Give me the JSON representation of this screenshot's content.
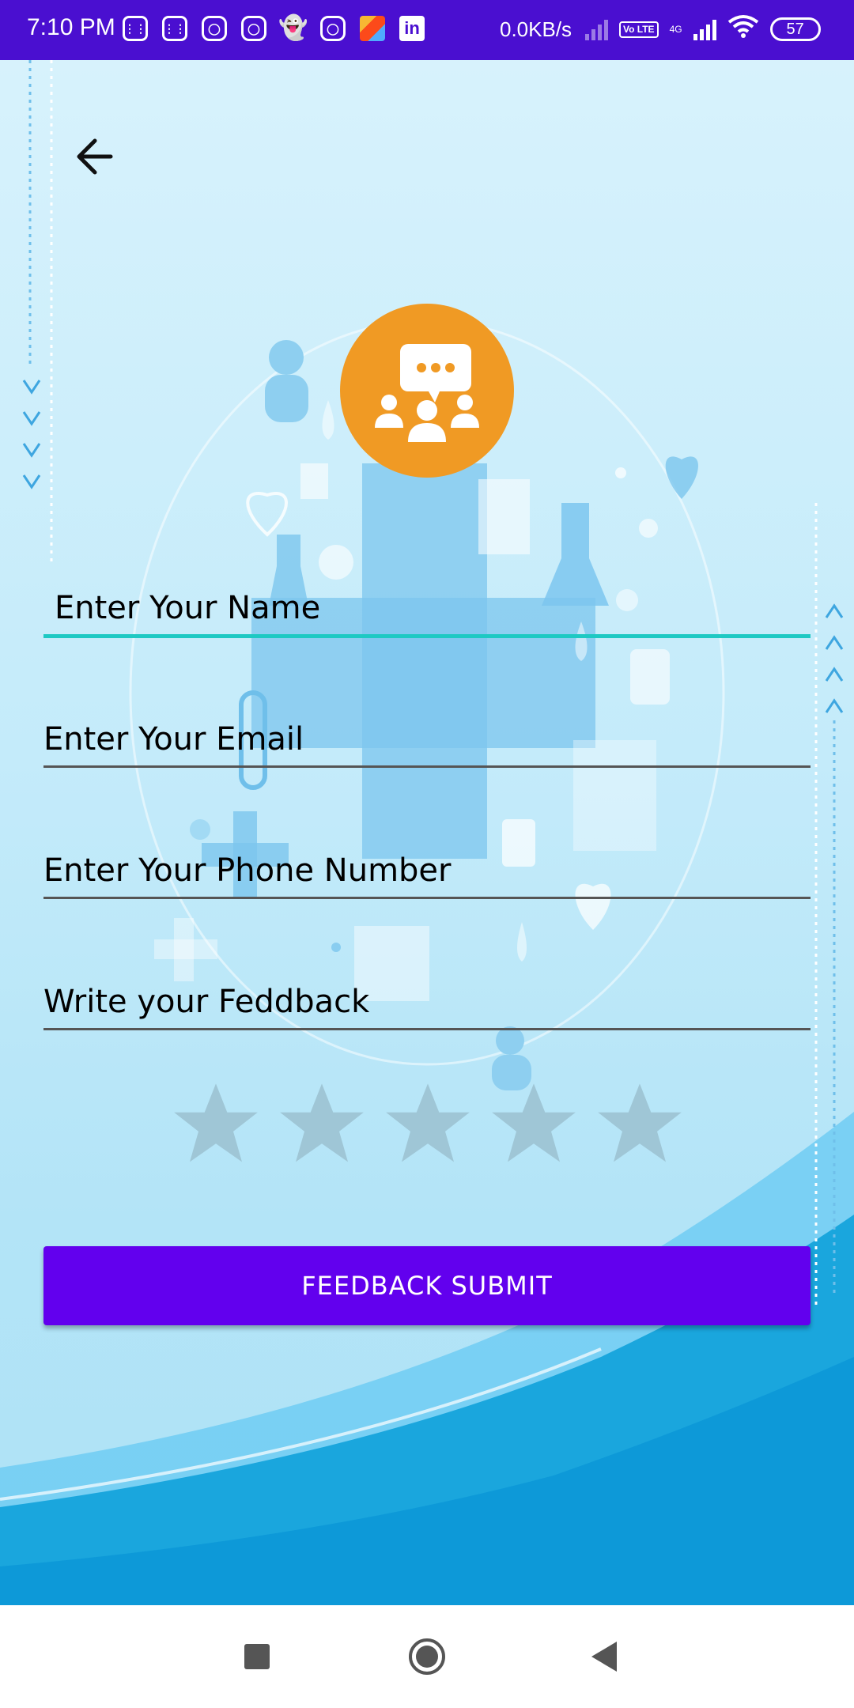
{
  "status_bar": {
    "time": "7:10 PM",
    "speed": "0.0KB/s",
    "network": "4G",
    "volte": "Vo LTE",
    "battery": "57",
    "icons": [
      "grid-app-icon",
      "grid-app-icon",
      "instagram-icon",
      "instagram-icon",
      "snapchat-icon",
      "instagram-icon",
      "kite-icon",
      "linkedin-icon"
    ]
  },
  "form": {
    "name_placeholder": "Enter Your Name",
    "email_placeholder": "Enter Your Email",
    "phone_placeholder": "Enter Your Phone Number",
    "feedback_placeholder": "Write your Feddback",
    "rating": 0,
    "rating_max": 5,
    "submit_label": "FEEDBACK SUBMIT"
  },
  "colors": {
    "status_bar": "#4a0fd0",
    "accent_orange": "#f09a24",
    "submit_button": "#6200ee",
    "active_underline": "#1ec9c3"
  }
}
